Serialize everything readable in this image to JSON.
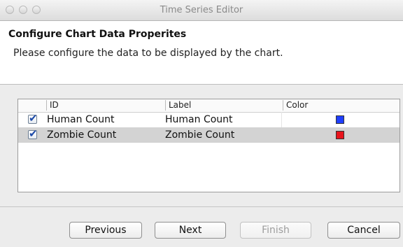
{
  "window": {
    "title": "Time Series Editor"
  },
  "header": {
    "title": "Configure Chart Data Properites",
    "description": "Please configure the data to be displayed by the chart."
  },
  "table": {
    "columns": [
      "ID",
      "Label",
      "Color"
    ],
    "rows": [
      {
        "checked": true,
        "id": "Human Count",
        "label": "Human Count",
        "color": "#1f3fff",
        "selected": false
      },
      {
        "checked": true,
        "id": "Zombie Count",
        "label": "Zombie Count",
        "color": "#e8141c",
        "selected": true
      }
    ]
  },
  "buttons": {
    "previous": "Previous",
    "next": "Next",
    "finish": "Finish",
    "cancel": "Cancel"
  }
}
